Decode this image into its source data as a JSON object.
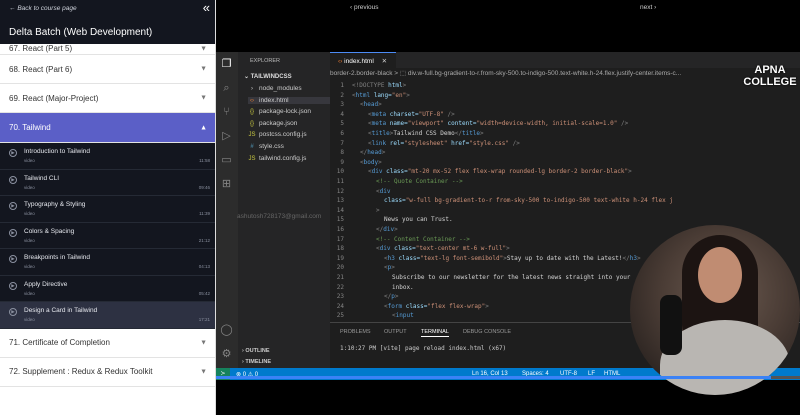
{
  "course": {
    "back_label": "Back to course page",
    "title": "Delta Batch (Web Development)",
    "sections_before": [
      "67. React (Part 5)",
      "68. React (Part 6)",
      "69. React (Major-Project)"
    ],
    "active_section": "70. Tailwind",
    "lessons": [
      {
        "title": "Introduction to Tailwind",
        "kind": "video",
        "duration": "11:58"
      },
      {
        "title": "Tailwind CLI",
        "kind": "video",
        "duration": "09:46"
      },
      {
        "title": "Typography & Styling",
        "kind": "video",
        "duration": "11:39"
      },
      {
        "title": "Colors & Spacing",
        "kind": "video",
        "duration": "21:12"
      },
      {
        "title": "Breakpoints in Tailwind",
        "kind": "video",
        "duration": "04:13"
      },
      {
        "title": "Apply Directive",
        "kind": "video",
        "duration": "05:42"
      },
      {
        "title": "Design a Card in Tailwind",
        "kind": "video",
        "duration": "17:21"
      }
    ],
    "sections_after": [
      "71. Certificate of Completion",
      "72. Supplement : Redux & Redux Toolkit"
    ]
  },
  "player": {
    "prev_label": "‹ previous",
    "next_label": "next ›",
    "progress": 0.95
  },
  "vscode": {
    "explorer_header": "EXPLORER",
    "project": "TAILWINDCSS",
    "files": [
      "node_modules",
      "index.html",
      "package-lock.json",
      "package.json",
      "postcss.config.js",
      "style.css",
      "tailwind.config.js"
    ],
    "watermark_email": "ashutosh728173@gmail.com",
    "outline": "OUTLINE",
    "timeline": "TIMELINE",
    "tab": "index.html",
    "breadcrumb": "border-2.border-black  >  ⬚ div.w-full.bg-gradient-to-r.from-sky-500.to-indigo-500.text-white.h-24.flex.justify-center.items-c...",
    "panel_tabs": [
      "PROBLEMS",
      "OUTPUT",
      "TERMINAL",
      "DEBUG CONSOLE"
    ],
    "terminal_output": "1:10:27 PM [vite] page reload index.html (x67)",
    "status": {
      "errors": "0",
      "warnings": "0",
      "position": "Ln 16, Col 13",
      "spaces": "Spaces: 4",
      "encoding": "UTF-8",
      "eol": "LF",
      "language": "HTML"
    }
  },
  "logo": {
    "line1": "APNA",
    "line2": "COLLEGE"
  },
  "icons": [
    "chevron-double-left-icon",
    "chevron-down-icon",
    "chevron-up-icon",
    "play-circle-icon",
    "files-icon",
    "search-icon",
    "source-control-icon",
    "run-debug-icon",
    "extensions-icon",
    "account-icon",
    "settings-gear-icon",
    "close-icon",
    "remote-icon",
    "error-icon",
    "warning-icon"
  ]
}
